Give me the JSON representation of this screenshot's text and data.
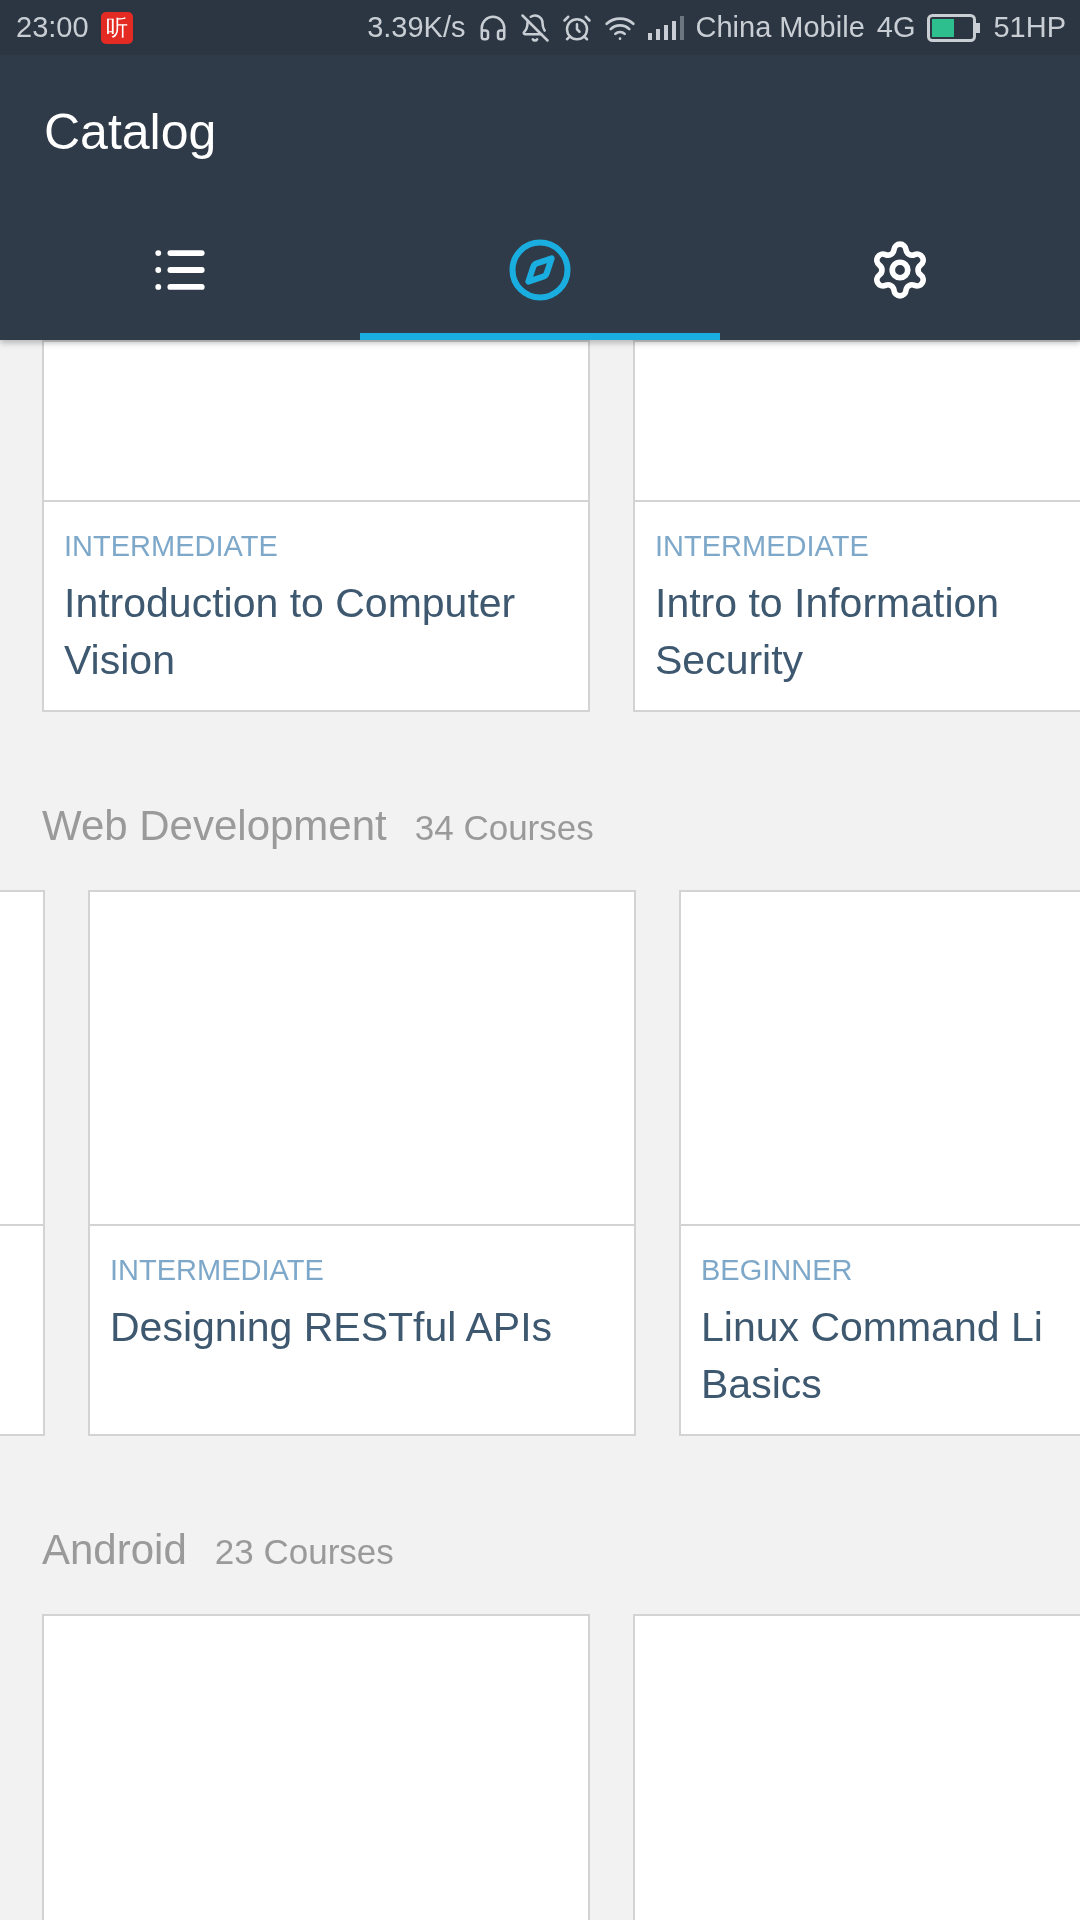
{
  "status_bar": {
    "time": "23:00",
    "app_badge": "听",
    "speed": "3.39K/s",
    "carrier": "China Mobile",
    "network": "4G",
    "battery": "51HP"
  },
  "app_bar": {
    "title": "Catalog"
  },
  "tabs": [
    {
      "kind": "list",
      "selected": false
    },
    {
      "kind": "compass",
      "selected": true
    },
    {
      "kind": "settings",
      "selected": false
    }
  ],
  "sections": [
    {
      "cards": [
        {
          "kind": "course",
          "level": "INTERMEDIATE",
          "title_lines": [
            "Introduction to Computer",
            "Vision"
          ]
        },
        {
          "kind": "course",
          "level": "INTERMEDIATE",
          "title_lines": [
            "Intro to Information",
            "Security"
          ]
        }
      ]
    },
    {
      "name": "Web Development",
      "count": "34 Courses",
      "cards": [
        {
          "kind": "partial"
        },
        {
          "kind": "course",
          "level": "INTERMEDIATE",
          "title_lines": [
            "Designing RESTful APIs"
          ]
        },
        {
          "kind": "course",
          "level": "BEGINNER",
          "title_lines": [
            "Linux Command Li",
            "Basics"
          ]
        }
      ]
    },
    {
      "name": "Android",
      "count": "23 Courses",
      "cards": [
        {
          "kind": "blank"
        },
        {
          "kind": "blank"
        }
      ]
    }
  ]
}
